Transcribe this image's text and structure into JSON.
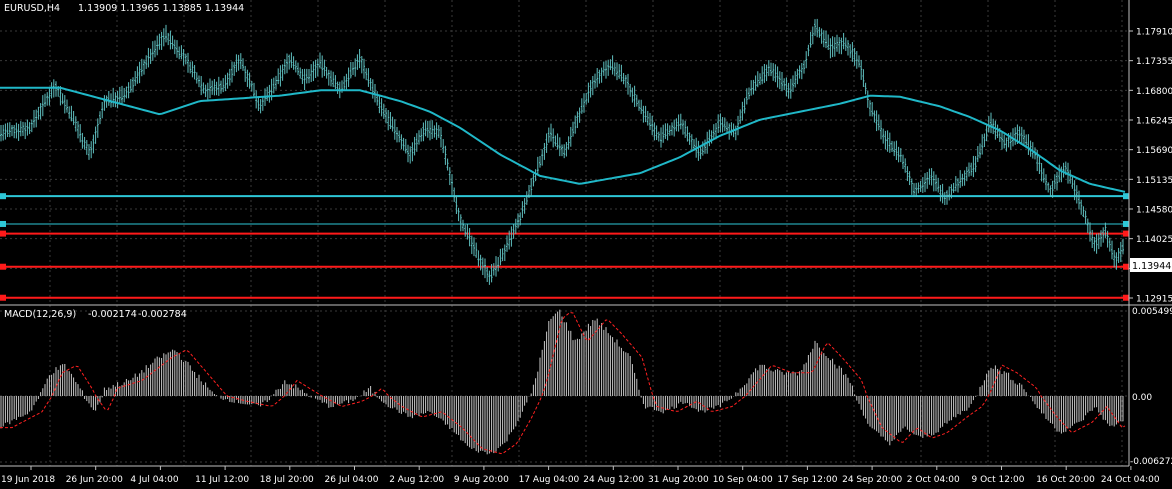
{
  "title": {
    "symbol": "EURUSD,H4",
    "ohlc": "1.13909 1.13965 1.13885 1.13944"
  },
  "price_axis": [
    "1.17910",
    "1.17355",
    "1.16800",
    "1.16245",
    "1.15690",
    "1.15135",
    "1.14580",
    "1.14025",
    "1.13470",
    "1.12915"
  ],
  "current_price": "1.13944",
  "macd": {
    "label": "MACD(12,26,9)",
    "main": "-0.002174",
    "signal": "-0.002784",
    "axis": [
      "0.005499",
      "0.00",
      "-0.006272"
    ]
  },
  "time_axis": [
    "19 Jun 2018",
    "26 Jun 20:00",
    "4 Jul 04:00",
    "11 Jul 12:00",
    "18 Jul 20:00",
    "26 Jul 04:00",
    "2 Aug 12:00",
    "9 Aug 20:00",
    "17 Aug 04:00",
    "24 Aug 12:00",
    "31 Aug 20:00",
    "10 Sep 04:00",
    "17 Sep 12:00",
    "24 Sep 20:00",
    "2 Oct 04:00",
    "9 Oct 12:00",
    "16 Oct 20:00",
    "24 Oct 04:00"
  ],
  "colors": {
    "background": "#000000",
    "candle_wick": "#5fbfbf",
    "moving_average": "#20b8c8",
    "horizontal_cyan": "#2ec8d8",
    "horizontal_red": "#ff1a1a",
    "grid": "#3a3a3a",
    "macd_hist": "#c8c8c8",
    "macd_signal": "#ff2020",
    "axis_text": "#ffffff"
  },
  "chart_data": {
    "type": "line",
    "symbol": "EURUSD",
    "timeframe": "H4",
    "ylim": [
      1.1262,
      1.1815
    ],
    "price_path": [
      [
        0,
        1.16
      ],
      [
        30,
        1.161
      ],
      [
        55,
        1.169
      ],
      [
        75,
        1.162
      ],
      [
        90,
        1.156
      ],
      [
        105,
        1.166
      ],
      [
        125,
        1.167
      ],
      [
        145,
        1.173
      ],
      [
        165,
        1.1785
      ],
      [
        185,
        1.174
      ],
      [
        205,
        1.168
      ],
      [
        225,
        1.169
      ],
      [
        240,
        1.174
      ],
      [
        260,
        1.165
      ],
      [
        275,
        1.169
      ],
      [
        290,
        1.174
      ],
      [
        305,
        1.17
      ],
      [
        320,
        1.173
      ],
      [
        340,
        1.168
      ],
      [
        360,
        1.174
      ],
      [
        380,
        1.165
      ],
      [
        400,
        1.159
      ],
      [
        410,
        1.156
      ],
      [
        425,
        1.161
      ],
      [
        440,
        1.16
      ],
      [
        450,
        1.152
      ],
      [
        460,
        1.144
      ],
      [
        475,
        1.138
      ],
      [
        490,
        1.133
      ],
      [
        505,
        1.138
      ],
      [
        520,
        1.144
      ],
      [
        535,
        1.152
      ],
      [
        550,
        1.16
      ],
      [
        565,
        1.156
      ],
      [
        580,
        1.164
      ],
      [
        595,
        1.17
      ],
      [
        610,
        1.173
      ],
      [
        625,
        1.17
      ],
      [
        640,
        1.165
      ],
      [
        660,
        1.159
      ],
      [
        680,
        1.162
      ],
      [
        700,
        1.156
      ],
      [
        720,
        1.162
      ],
      [
        735,
        1.16
      ],
      [
        750,
        1.168
      ],
      [
        770,
        1.172
      ],
      [
        790,
        1.168
      ],
      [
        805,
        1.173
      ],
      [
        815,
        1.18
      ],
      [
        830,
        1.176
      ],
      [
        845,
        1.177
      ],
      [
        860,
        1.173
      ],
      [
        870,
        1.165
      ],
      [
        885,
        1.159
      ],
      [
        900,
        1.156
      ],
      [
        915,
        1.149
      ],
      [
        930,
        1.152
      ],
      [
        945,
        1.148
      ],
      [
        960,
        1.151
      ],
      [
        975,
        1.154
      ],
      [
        990,
        1.162
      ],
      [
        1005,
        1.158
      ],
      [
        1020,
        1.16
      ],
      [
        1035,
        1.156
      ],
      [
        1050,
        1.149
      ],
      [
        1065,
        1.154
      ],
      [
        1080,
        1.147
      ],
      [
        1095,
        1.139
      ],
      [
        1105,
        1.142
      ],
      [
        1115,
        1.136
      ],
      [
        1125,
        1.1394
      ]
    ],
    "moving_average": [
      [
        0,
        1.1685
      ],
      [
        60,
        1.1685
      ],
      [
        100,
        1.1665
      ],
      [
        140,
        1.1645
      ],
      [
        160,
        1.1635
      ],
      [
        200,
        1.166
      ],
      [
        240,
        1.1665
      ],
      [
        280,
        1.167
      ],
      [
        320,
        1.168
      ],
      [
        360,
        1.168
      ],
      [
        400,
        1.166
      ],
      [
        430,
        1.164
      ],
      [
        460,
        1.161
      ],
      [
        500,
        1.156
      ],
      [
        540,
        1.152
      ],
      [
        580,
        1.1505
      ],
      [
        610,
        1.1515
      ],
      [
        640,
        1.1525
      ],
      [
        680,
        1.1555
      ],
      [
        720,
        1.1595
      ],
      [
        760,
        1.1625
      ],
      [
        800,
        1.164
      ],
      [
        840,
        1.1655
      ],
      [
        870,
        1.167
      ],
      [
        900,
        1.1668
      ],
      [
        940,
        1.165
      ],
      [
        970,
        1.163
      ],
      [
        1000,
        1.1605
      ],
      [
        1030,
        1.157
      ],
      [
        1060,
        1.153
      ],
      [
        1090,
        1.1505
      ],
      [
        1125,
        1.149
      ]
    ],
    "horizontal_levels": [
      {
        "price": 1.1482,
        "color": "cyan",
        "width": 2
      },
      {
        "price": 1.143,
        "color": "cyan",
        "width": 1
      },
      {
        "price": 1.1412,
        "color": "red",
        "width": 2
      },
      {
        "price": 1.135,
        "color": "red",
        "width": 2
      },
      {
        "price": 1.1292,
        "color": "red",
        "width": 2
      }
    ],
    "macd_hist": [
      [
        0,
        -0.003
      ],
      [
        30,
        -0.0015
      ],
      [
        50,
        0.0015
      ],
      [
        65,
        0.002
      ],
      [
        80,
        0.0005
      ],
      [
        95,
        -0.0015
      ],
      [
        105,
        0.0005
      ],
      [
        130,
        0.001
      ],
      [
        160,
        0.0025
      ],
      [
        175,
        0.003
      ],
      [
        195,
        0.0015
      ],
      [
        215,
        0.0
      ],
      [
        235,
        -0.0005
      ],
      [
        260,
        -0.001
      ],
      [
        285,
        0.001
      ],
      [
        310,
        0.0
      ],
      [
        330,
        -0.001
      ],
      [
        350,
        -0.0005
      ],
      [
        370,
        0.0005
      ],
      [
        390,
        -0.001
      ],
      [
        410,
        -0.002
      ],
      [
        430,
        -0.0015
      ],
      [
        450,
        -0.003
      ],
      [
        470,
        -0.005
      ],
      [
        490,
        -0.0055
      ],
      [
        505,
        -0.0045
      ],
      [
        520,
        -0.002
      ],
      [
        535,
        0.001
      ],
      [
        550,
        0.005
      ],
      [
        560,
        0.0055
      ],
      [
        575,
        0.0035
      ],
      [
        595,
        0.005
      ],
      [
        610,
        0.004
      ],
      [
        630,
        0.0025
      ],
      [
        645,
        -0.001
      ],
      [
        665,
        -0.0015
      ],
      [
        685,
        -0.0005
      ],
      [
        700,
        -0.0015
      ],
      [
        720,
        -0.001
      ],
      [
        740,
        0.0005
      ],
      [
        760,
        0.002
      ],
      [
        780,
        0.0015
      ],
      [
        800,
        0.0015
      ],
      [
        815,
        0.0035
      ],
      [
        830,
        0.0025
      ],
      [
        850,
        0.001
      ],
      [
        870,
        -0.003
      ],
      [
        890,
        -0.0045
      ],
      [
        905,
        -0.003
      ],
      [
        920,
        -0.004
      ],
      [
        935,
        -0.0035
      ],
      [
        955,
        -0.002
      ],
      [
        970,
        -0.001
      ],
      [
        990,
        0.002
      ],
      [
        1005,
        0.0015
      ],
      [
        1025,
        0.0005
      ],
      [
        1045,
        -0.002
      ],
      [
        1060,
        -0.0035
      ],
      [
        1080,
        -0.0025
      ],
      [
        1095,
        -0.001
      ],
      [
        1110,
        -0.003
      ],
      [
        1125,
        -0.0022
      ]
    ],
    "macd_ylim": [
      -0.006272,
      0.005499
    ]
  }
}
